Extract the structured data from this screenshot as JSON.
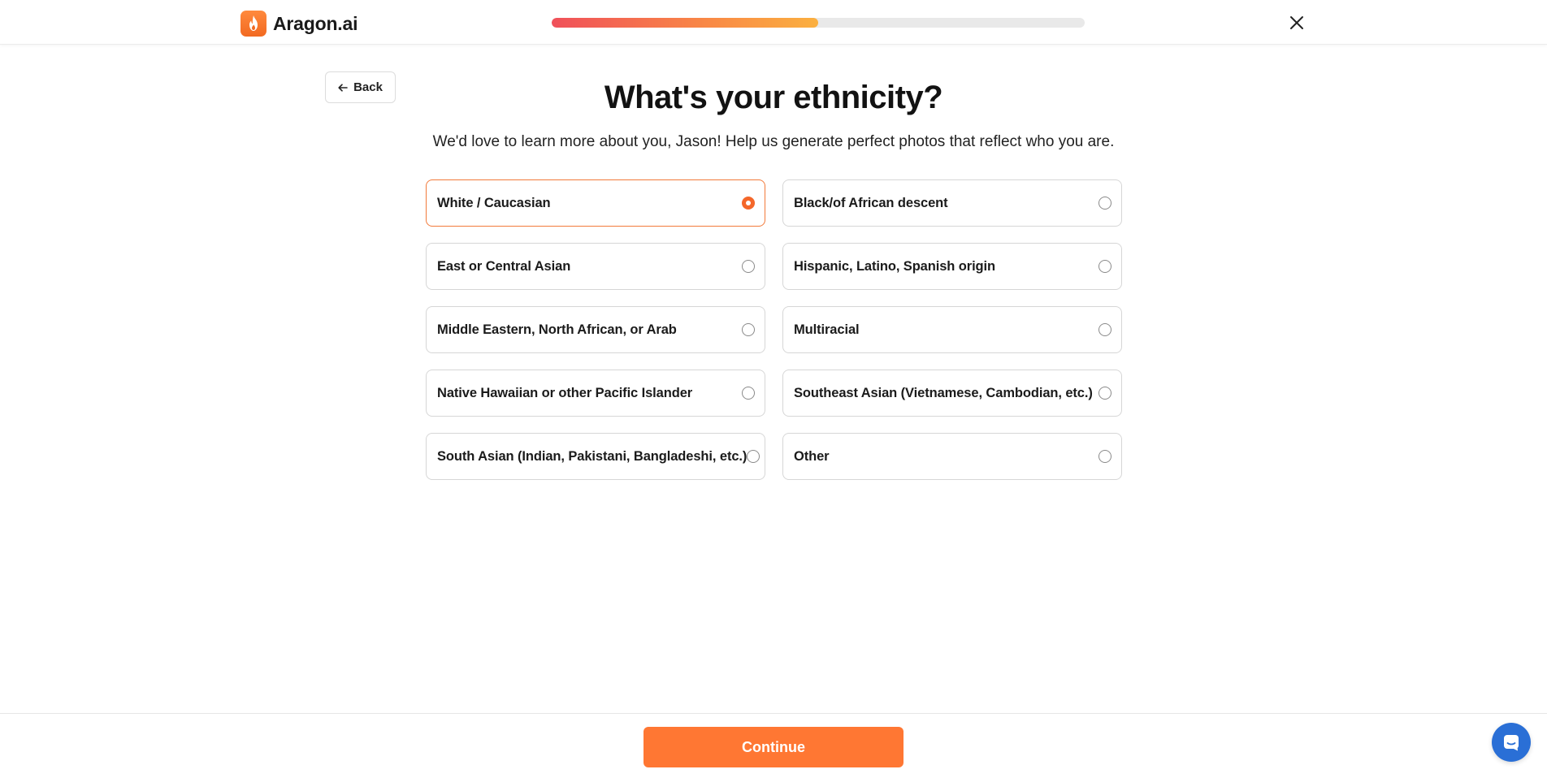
{
  "brand": {
    "name": "Aragon.ai",
    "accent_color": "#ff7733"
  },
  "progress": {
    "fraction": 0.5
  },
  "header": {
    "close_icon": "close-icon"
  },
  "back_button": {
    "label": "Back",
    "icon": "arrow-left-icon"
  },
  "question": {
    "title": "What's your ethnicity?",
    "subtitle": "We'd love to learn more about you, Jason! Help us generate perfect photos that reflect who you are."
  },
  "options": [
    {
      "label": "White / Caucasian",
      "selected": true
    },
    {
      "label": "Black/of African descent",
      "selected": false
    },
    {
      "label": "East or Central Asian",
      "selected": false
    },
    {
      "label": "Hispanic, Latino, Spanish origin",
      "selected": false
    },
    {
      "label": "Middle Eastern, North African, or Arab",
      "selected": false
    },
    {
      "label": "Multiracial",
      "selected": false
    },
    {
      "label": "Native Hawaiian or other Pacific Islander",
      "selected": false
    },
    {
      "label": "Southeast Asian (Vietnamese, Cambodian, etc.)",
      "selected": false
    },
    {
      "label": "South Asian (Indian, Pakistani, Bangladeshi, etc.)",
      "selected": false
    },
    {
      "label": "Other",
      "selected": false
    }
  ],
  "footer": {
    "continue_label": "Continue",
    "chat_icon": "chat-icon"
  }
}
